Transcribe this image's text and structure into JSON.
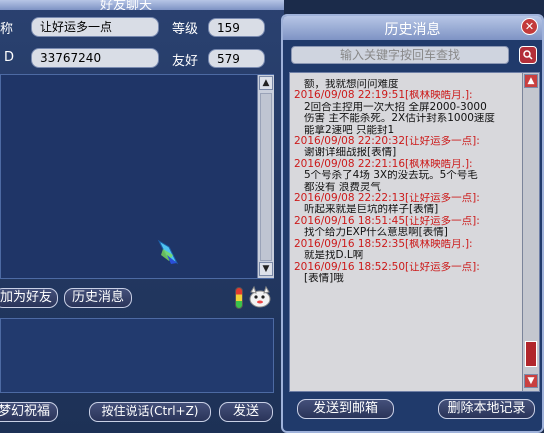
{
  "left": {
    "title": "好友聊天",
    "nickname_label": "称",
    "nickname_value": "让好运多一点",
    "level_label": "等级",
    "level_value": "159",
    "id_label": "D",
    "id_value": "33767240",
    "friend_label": "友好",
    "friend_value": "579",
    "add_friend_label": "加为好友",
    "history_label": "历史消息",
    "send_as_label": "梦幻祝福",
    "hold_talk_label": "按住说话(Ctrl+Z)",
    "send_label": "发送"
  },
  "right": {
    "title": "历史消息",
    "close_symbol": "✕",
    "search_placeholder": "输入关键字按回车查找",
    "send_mail_label": "发送到邮箱",
    "delete_label": "删除本地记录",
    "history": [
      {
        "type": "text",
        "text": "额，我就想问问难度"
      },
      {
        "type": "header",
        "text": "2016/09/08 22:19:51[枫林映皓月.]:"
      },
      {
        "type": "text",
        "text": "2回合主控用一次大招 全屏2000-3000"
      },
      {
        "type": "text",
        "text": "伤害   主不能杀死。2X估计封系1000速度"
      },
      {
        "type": "text",
        "text": "能拿2速吧 只能封1"
      },
      {
        "type": "header",
        "text": "2016/09/08 22:20:32[让好运多一点]:"
      },
      {
        "type": "text",
        "text": "谢谢详细战报[表情]"
      },
      {
        "type": "header",
        "text": "2016/09/08 22:21:16[枫林映皓月.]:"
      },
      {
        "type": "text",
        "text": "5个号杀了4场  3X的没去玩。5个号毛"
      },
      {
        "type": "text",
        "text": "都没有 浪费灵气"
      },
      {
        "type": "header",
        "text": "2016/09/08 22:22:13[让好运多一点]:"
      },
      {
        "type": "text",
        "text": "听起来就是巨坑的样子[表情]"
      },
      {
        "type": "header",
        "text": "2016/09/16 18:51:45[让好运多一点]:"
      },
      {
        "type": "text",
        "text": "找个给力EXP什么意思啊[表情]"
      },
      {
        "type": "header",
        "text": "2016/09/16 18:52:35[枫林映皓月.]:"
      },
      {
        "type": "text",
        "text": "就是找D.L啊"
      },
      {
        "type": "header",
        "text": "2016/09/16 18:52:50[让好运多一点]:"
      },
      {
        "type": "text",
        "text": "[表情]哦"
      }
    ]
  },
  "colors": {
    "accent_red": "#cc1a1a",
    "panel_blue": "#203a6b"
  }
}
